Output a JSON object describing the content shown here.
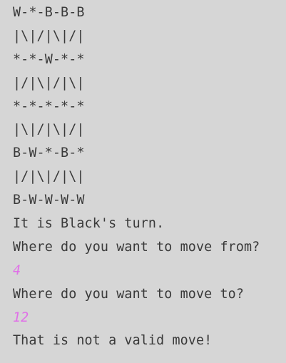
{
  "console": {
    "board": [
      "W-*-B-B-B",
      "|\\|/|\\|/|",
      "*-*-W-*-*",
      "|/|\\|/|\\|",
      "*-*-*-*-*",
      "|\\|/|\\|/|",
      "B-W-*-B-*",
      "|/|\\|/|\\|",
      "B-W-W-W-W"
    ],
    "turn_message": "It is Black's turn.",
    "from_prompt": "Where do you want to move from?",
    "from_input": "4",
    "to_prompt": "Where do you want to move to?",
    "to_input": "12",
    "error_message": "That is not a valid move!"
  },
  "colors": {
    "background": "#d6d6d6",
    "text": "#3a3a3a",
    "user_input": "#e070e8"
  }
}
